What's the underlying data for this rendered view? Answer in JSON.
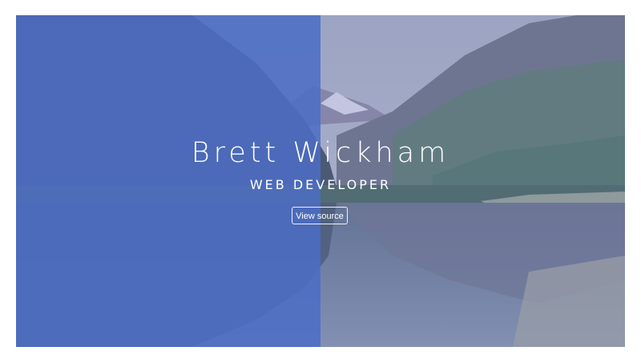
{
  "hero": {
    "name": "Brett Wickham",
    "role": "WEB DEVELOPER",
    "button_label": "View source"
  },
  "colors": {
    "overlay_blue": "#4e6ec4",
    "text": "#ffffff"
  },
  "background": {
    "description_icon": "mountain-lake-photo"
  }
}
